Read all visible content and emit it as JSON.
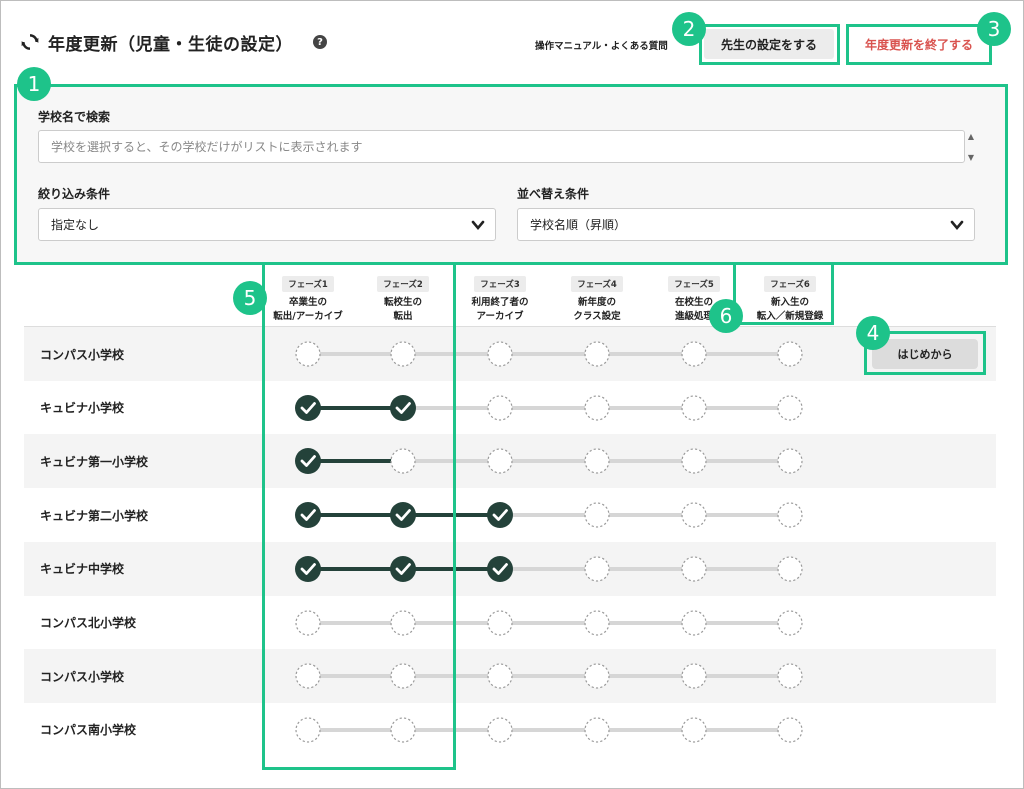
{
  "header": {
    "title": "年度更新（児童・生徒の設定）",
    "help_icon_text": "?",
    "manual_link": "操作マニュアル・よくある質問",
    "teacher_button": "先生の設定をする",
    "end_button": "年度更新を終了する"
  },
  "filters": {
    "search_label": "学校名で検索",
    "search_placeholder": "学校を選択すると、その学校だけがリストに表示されます",
    "filter_label": "絞り込み条件",
    "filter_value": "指定なし",
    "sort_label": "並べ替え条件",
    "sort_value": "学校名順（昇順）"
  },
  "phases": [
    {
      "badge": "フェーズ1",
      "line1": "卒業生の",
      "line2": "転出/アーカイブ"
    },
    {
      "badge": "フェーズ2",
      "line1": "転校生の",
      "line2": "転出"
    },
    {
      "badge": "フェーズ3",
      "line1": "利用終了者の",
      "line2": "アーカイブ"
    },
    {
      "badge": "フェーズ4",
      "line1": "新年度の",
      "line2": "クラス設定"
    },
    {
      "badge": "フェーズ5",
      "line1": "在校生の",
      "line2": "進級処理"
    },
    {
      "badge": "フェーズ6",
      "line1": "新入生の",
      "line2": "転入／新規登録"
    }
  ],
  "schools": [
    {
      "name": "コンパス小学校",
      "completed": 0
    },
    {
      "name": "キュビナ小学校",
      "completed": 2
    },
    {
      "name": "キュビナ第一小学校",
      "completed": 1
    },
    {
      "name": "キュビナ第二小学校",
      "completed": 3
    },
    {
      "name": "キュビナ中学校",
      "completed": 3
    },
    {
      "name": "コンパス北小学校",
      "completed": 0
    },
    {
      "name": "コンパス小学校",
      "completed": 0
    },
    {
      "name": "コンパス南小学校",
      "completed": 0
    }
  ],
  "start_button": "はじめから",
  "callouts": [
    "1",
    "2",
    "3",
    "4",
    "5",
    "6"
  ],
  "colors": {
    "accent": "#1ec38a",
    "done": "#24423a",
    "danger": "#d9534f",
    "track": "#d6d6d6"
  }
}
